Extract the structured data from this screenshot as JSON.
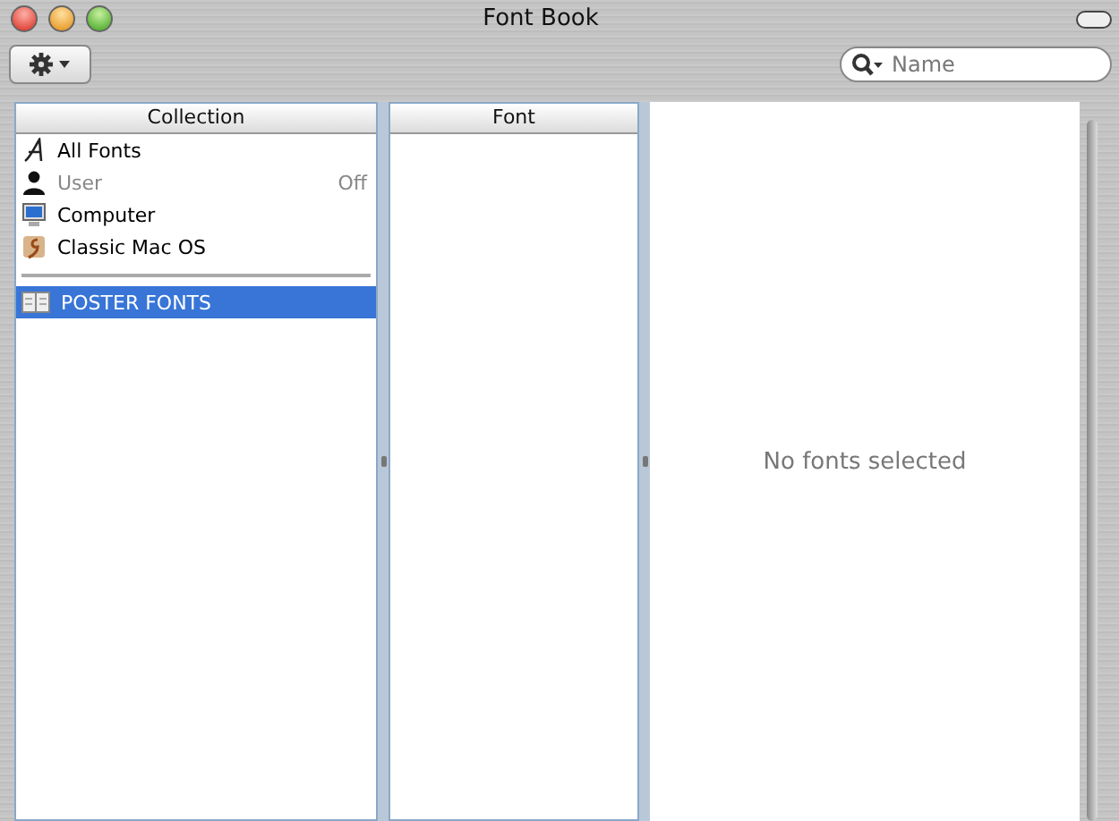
{
  "window": {
    "title": "Font Book"
  },
  "search": {
    "placeholder": "Name"
  },
  "collection_pane": {
    "heading": "Collection",
    "collections": [
      {
        "kind": "all",
        "label": "All Fonts",
        "disabled": false,
        "selected": false
      },
      {
        "kind": "user",
        "label": "User",
        "status": "Off",
        "disabled": true,
        "selected": false
      },
      {
        "kind": "computer",
        "label": "Computer",
        "disabled": false,
        "selected": false
      },
      {
        "kind": "classic",
        "label": "Classic Mac OS",
        "disabled": false,
        "selected": false
      }
    ],
    "libraries": [
      {
        "kind": "library",
        "label": "POSTER FONTS",
        "disabled": false,
        "selected": true
      }
    ]
  },
  "font_pane": {
    "heading": "Font"
  },
  "preview": {
    "message": "No fonts selected"
  }
}
